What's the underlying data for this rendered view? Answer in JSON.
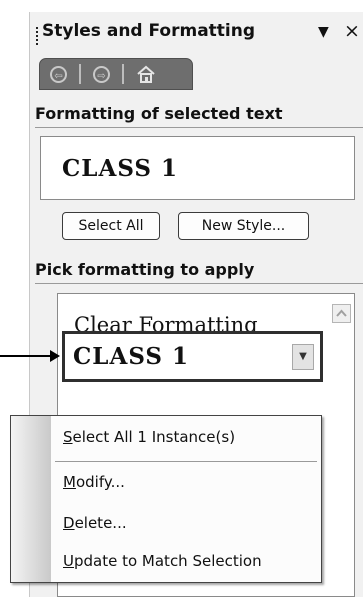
{
  "panel": {
    "title": "Styles and Formatting",
    "dropdown_glyph": "▼",
    "close_glyph": "×",
    "nav": {
      "back_glyph": "⇦",
      "forward_glyph": "⇨",
      "home_icon": "home-icon"
    }
  },
  "selected_text": {
    "heading": "Formatting of selected text",
    "style_name": "CLASS 1",
    "buttons": {
      "select_all": "Select All",
      "new_style": "New Style..."
    }
  },
  "pick": {
    "heading": "Pick formatting to apply",
    "items": [
      {
        "label": "Clear Formatting"
      },
      {
        "label": "CLASS 1",
        "selected": true
      }
    ],
    "dropdown_glyph": "▼"
  },
  "context_menu": {
    "items": [
      {
        "accel": "S",
        "rest": "elect All 1 Instance(s)"
      },
      {
        "accel": "M",
        "rest": "odify..."
      },
      {
        "accel": "D",
        "rest": "elete..."
      },
      {
        "accel": "U",
        "rest": "pdate to Match Selection"
      }
    ]
  },
  "colors": {
    "panel_bg": "#f1f1f1",
    "nav_bg": "#6e6e6e",
    "menu_bg": "#fcfcfc"
  }
}
